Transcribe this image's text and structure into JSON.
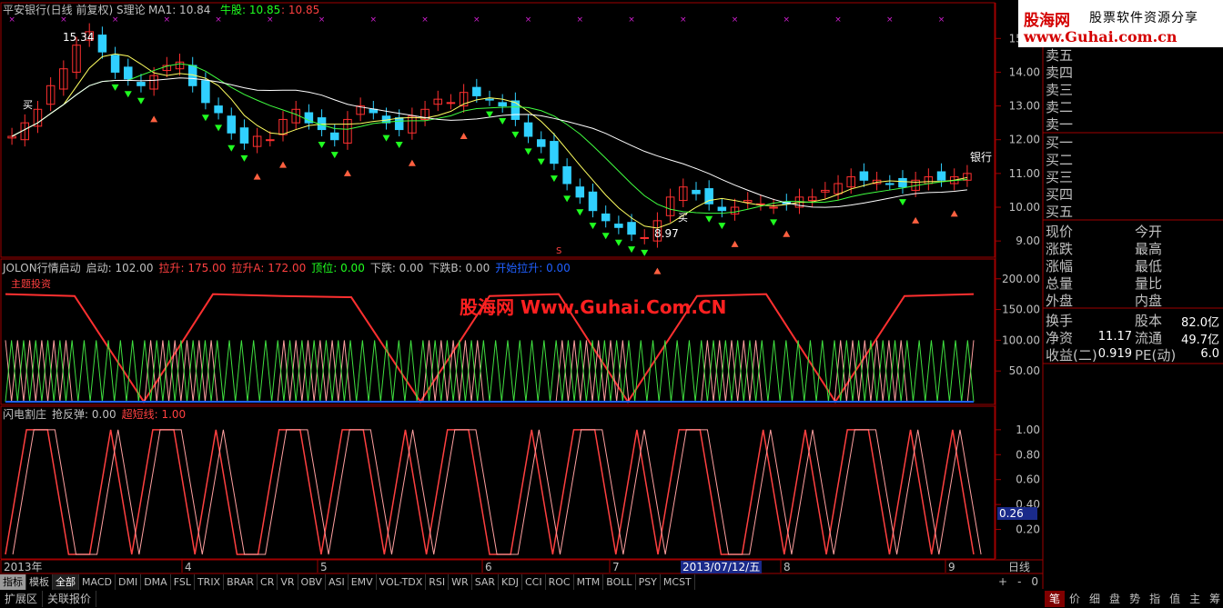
{
  "header": {
    "title": "平安银行(日线 前复权) S理论",
    "ma1": "MA1: 10.84",
    "niu": "牛股: 10.85",
    "niu2": ": 10.85"
  },
  "brand": {
    "logo": "股海网",
    "tagline": "股票软件资源分享",
    "url": "www.Guhai.com.cn"
  },
  "watermark": "股海网 Www.Guhai.Com.CN",
  "panel2": {
    "name": "JOLON行情启动",
    "items": [
      {
        "label": "启动: 102.00",
        "color": "#c0c0c0"
      },
      {
        "label": "拉升: 175.00",
        "color": "#ff4040"
      },
      {
        "label": "拉升A: 172.00",
        "color": "#ff4040"
      },
      {
        "label": "顶位: 0.00",
        "color": "#20ff20"
      },
      {
        "label": "下跌: 0.00",
        "color": "#c0c0c0"
      },
      {
        "label": "下跌B: 0.00",
        "color": "#c0c0c0"
      },
      {
        "label": "开始拉升: 0.00",
        "color": "#2060ff"
      }
    ],
    "label_zhuli": "主题投资"
  },
  "panel3": {
    "name": "闪电割庄",
    "items": [
      {
        "label": "抢反弹: 0.00",
        "color": "#c0c0c0"
      },
      {
        "label": "超短线: 1.00",
        "color": "#ff4040"
      }
    ],
    "current_value": "0.26"
  },
  "chart_annotations": {
    "high_label": "15.34",
    "low_label": "8.97",
    "stock_tag": "银行",
    "buy_marker": "买",
    "s_marker": "S"
  },
  "xaxis": {
    "labels": [
      "2013年",
      "4",
      "5",
      "6",
      "7",
      "8",
      "9"
    ],
    "cursor_date": "2013/07/12/五",
    "period": "日线"
  },
  "order_book": {
    "sells": [
      "卖五",
      "卖四",
      "卖三",
      "卖二",
      "卖一"
    ],
    "buys": [
      "买一",
      "买二",
      "买三",
      "买四",
      "买五"
    ]
  },
  "quote": {
    "left_labels": [
      "现价",
      "涨跌",
      "涨幅",
      "总量",
      "外盘"
    ],
    "right_labels": [
      "今开",
      "最高",
      "最低",
      "量比",
      "内盘"
    ],
    "rows": [
      {
        "l": "换手",
        "lv": "",
        "r": "股本",
        "rv": "82.0亿"
      },
      {
        "l": "净资",
        "lv": "11.17",
        "r": "流通",
        "rv": "49.7亿"
      },
      {
        "l": "收益(二)",
        "lv": "0.919",
        "r": "PE(动)",
        "rv": "6.0"
      }
    ]
  },
  "tabs": [
    "指标",
    "模板",
    "全部",
    "MACD",
    "DMI",
    "DMA",
    "FSL",
    "TRIX",
    "BRAR",
    "CR",
    "VR",
    "OBV",
    "ASI",
    "EMV",
    "VOL-TDX",
    "RSI",
    "WR",
    "SAR",
    "KDJ",
    "CCI",
    "ROC",
    "MTM",
    "BOLL",
    "PSY",
    "MCST"
  ],
  "bottom_tabs": [
    "扩展区",
    "关联报价"
  ],
  "right_tabs": [
    "笔",
    "价",
    "细",
    "盘",
    "势",
    "指",
    "值",
    "主",
    "筹"
  ],
  "zoom_controls": [
    "+",
    "-",
    "0"
  ],
  "chart_data": [
    {
      "type": "candlestick",
      "title": "平安银行(日线 前复权)",
      "y_ticks": [
        9.0,
        10.0,
        11.0,
        12.0,
        13.0,
        14.0,
        15.0
      ],
      "ylim": [
        8.6,
        15.6
      ],
      "series": [
        {
          "name": "close",
          "values": [
            12.1,
            12.5,
            12.9,
            13.6,
            14.1,
            14.8,
            15.2,
            14.6,
            14.0,
            13.8,
            13.6,
            13.9,
            14.2,
            14.3,
            13.6,
            13.1,
            12.8,
            12.2,
            11.9,
            12.1,
            12.0,
            12.6,
            12.9,
            12.5,
            12.3,
            12.0,
            12.6,
            13.0,
            12.8,
            12.5,
            12.3,
            12.7,
            12.9,
            13.2,
            13.1,
            13.4,
            13.3,
            13.2,
            13.0,
            12.6,
            12.1,
            11.8,
            11.3,
            10.7,
            10.3,
            9.9,
            9.6,
            9.4,
            9.2,
            9.1,
            9.6,
            10.3,
            10.6,
            10.4,
            10.1,
            9.9,
            10.0,
            10.2,
            10.1,
            10.0,
            10.1,
            10.3,
            10.3,
            10.5,
            10.7,
            10.9,
            10.8,
            10.8,
            10.7,
            10.6,
            10.8,
            10.9,
            10.8,
            10.9,
            11.0
          ]
        }
      ]
    },
    {
      "type": "line",
      "title": "JOLON行情启动",
      "y_ticks": [
        50.0,
        100.0,
        150.0,
        200.0
      ],
      "ylim": [
        0,
        210
      ],
      "series": [
        {
          "name": "拉升",
          "values": [
            175,
            172,
            0,
            175,
            172,
            170,
            0,
            172,
            175,
            0,
            172,
            175,
            0,
            172,
            175
          ]
        },
        {
          "name": "启动",
          "values": [
            100,
            0,
            100,
            0,
            100,
            0,
            100,
            0,
            100,
            0,
            100,
            0,
            100,
            0,
            100
          ]
        }
      ]
    },
    {
      "type": "line",
      "title": "闪电割庄",
      "y_ticks": [
        0.2,
        0.4,
        0.6,
        0.8,
        1.0
      ],
      "ylim": [
        0,
        1.05
      ],
      "series": [
        {
          "name": "超短线",
          "values": [
            0,
            1,
            1,
            0,
            0,
            1,
            0,
            1,
            1,
            0,
            1,
            0,
            0,
            1,
            1,
            0,
            1,
            1,
            0,
            1,
            0,
            1,
            1,
            0,
            0,
            1,
            0,
            1,
            1,
            0,
            1,
            0,
            1,
            1,
            0,
            0,
            1,
            0,
            1,
            0,
            1,
            1,
            0,
            1,
            0,
            1,
            0
          ]
        }
      ]
    }
  ]
}
